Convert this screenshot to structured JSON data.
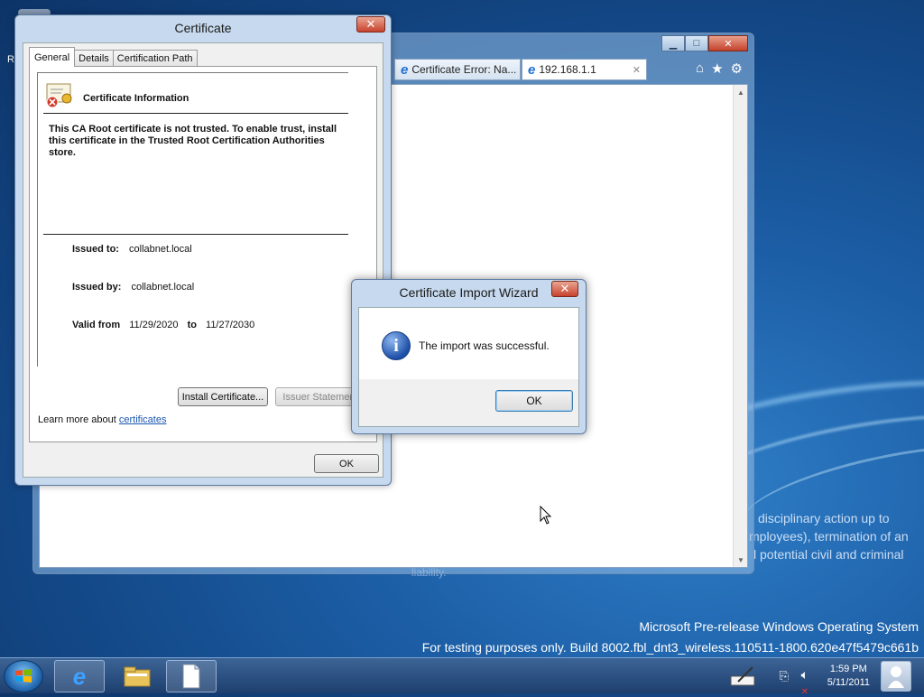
{
  "desktop": {
    "bg_text_lines": [
      "disciplinary action up to",
      "mployees), termination of an",
      "l potential civil and criminal",
      "liability."
    ],
    "watermark_line1": "Microsoft Pre-release Windows Operating System",
    "watermark_line2": "For testing purposes only. Build 8002.fbl_dnt3_wireless.110511-1800.620e47f5479c661b",
    "edge_letter": "R"
  },
  "browser": {
    "tabs": [
      {
        "label": "Certificate Error: Na...",
        "icon": "ie-icon"
      },
      {
        "label": "192.168.1.1",
        "icon": "ie-icon"
      }
    ],
    "toolbar_icons": [
      "home-icon",
      "favorites-star-icon",
      "tools-gear-icon"
    ]
  },
  "certificate_dialog": {
    "title": "Certificate",
    "tabs": [
      "General",
      "Details",
      "Certification Path"
    ],
    "heading": "Certificate Information",
    "message": "This CA Root certificate is not trusted. To enable trust, install this certificate in the Trusted Root Certification Authorities store.",
    "issued_to_label": "Issued to:",
    "issued_to_value": "collabnet.local",
    "issued_by_label": "Issued by:",
    "issued_by_value": "collabnet.local",
    "valid_from_label": "Valid from",
    "valid_from_value": "11/29/2020",
    "valid_to_label": "to",
    "valid_to_value": "11/27/2030",
    "install_button": "Install Certificate...",
    "issuer_button": "Issuer Statement",
    "learn_more_prefix": "Learn more about",
    "learn_more_link": "certificates",
    "ok_button": "OK"
  },
  "wizard_dialog": {
    "title": "Certificate Import Wizard",
    "message": "The import was successful.",
    "ok_button": "OK",
    "icon": "info-icon"
  },
  "taskbar": {
    "time": "1:59 PM",
    "date": "5/11/2011",
    "pinned": [
      "internet-explorer-icon",
      "file-explorer-icon",
      "document-icon"
    ]
  }
}
